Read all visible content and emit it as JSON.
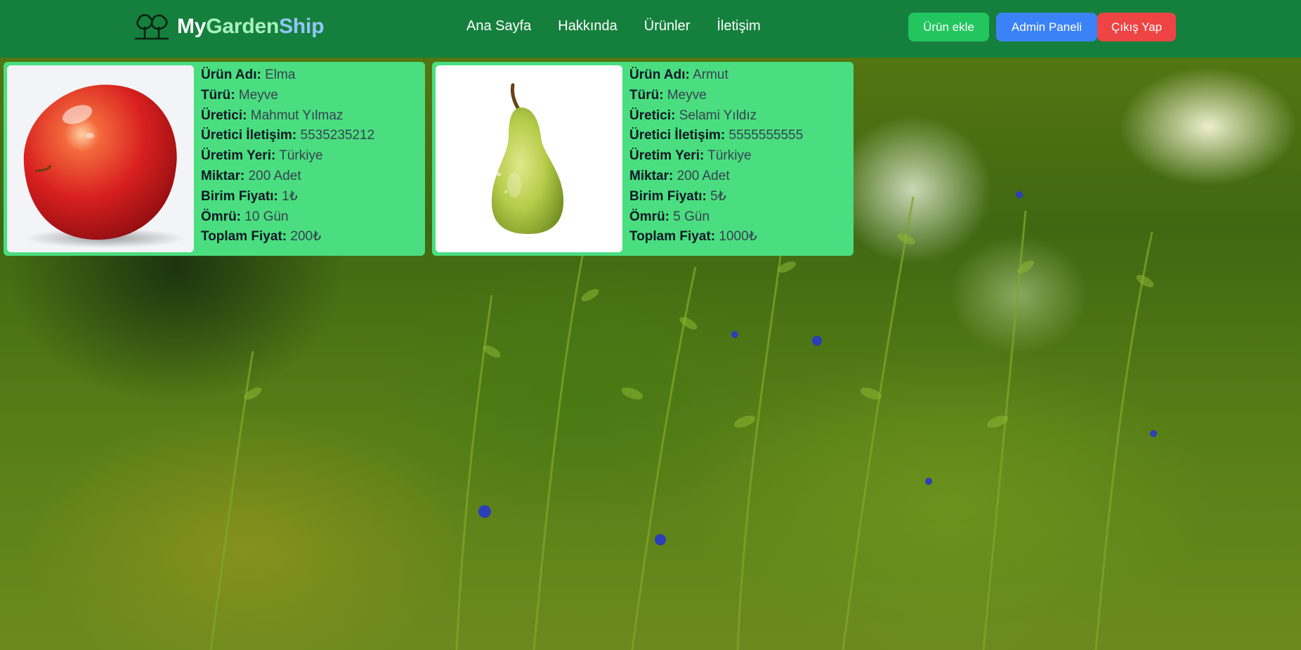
{
  "brand": {
    "part1": "My",
    "part2": "Garden",
    "part3": "Ship"
  },
  "nav": {
    "links": [
      "Ana Sayfa",
      "Hakkında",
      "Ürünler",
      "İletişim"
    ],
    "add_product": "Ürün ekle",
    "admin_panel": "Admin Paneli",
    "logout": "Çıkış Yap"
  },
  "labels": {
    "name": "Ürün Adı:",
    "type": "Türü:",
    "producer": "Üretici:",
    "producer_contact": "Üretici İletişim:",
    "origin": "Üretim Yeri:",
    "quantity": "Miktar:",
    "unit_price": "Birim Fiyatı:",
    "lifetime": "Ömrü:",
    "total_price": "Toplam Fiyat:"
  },
  "products": [
    {
      "name": "Elma",
      "type": "Meyve",
      "producer": "Mahmut Yılmaz",
      "producer_contact": "5535235212",
      "origin": "Türkiye",
      "quantity": "200 Adet",
      "unit_price": "1₺",
      "lifetime": "10 Gün",
      "total_price": "200₺",
      "image_icon": "apple"
    },
    {
      "name": "Armut",
      "type": "Meyve",
      "producer": "Selami Yıldız",
      "producer_contact": "5555555555",
      "origin": "Türkiye",
      "quantity": "200 Adet",
      "unit_price": "5₺",
      "lifetime": "5 Gün",
      "total_price": "1000₺",
      "image_icon": "pear"
    }
  ],
  "colors": {
    "navbar": "#15803d",
    "card": "#4ade80",
    "add_button": "#22c55e",
    "admin_button": "#3b82f6",
    "logout_button": "#ef4444"
  }
}
